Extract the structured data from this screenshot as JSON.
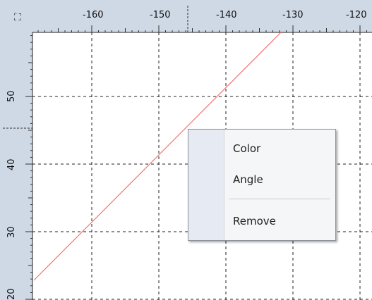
{
  "corner_icon": "crosshair-settings-icon",
  "ruler_top": {
    "labels": [
      "-160",
      "-150",
      "-140",
      "-130",
      "-120"
    ]
  },
  "ruler_left": {
    "labels": [
      "50",
      "40",
      "30",
      "20"
    ]
  },
  "plot": {
    "grid_style": "dashed",
    "line_color": "#ff6b6b"
  },
  "context_menu": {
    "items": [
      {
        "label": "Color"
      },
      {
        "label": "Angle"
      },
      {
        "label": "Remove"
      }
    ]
  }
}
